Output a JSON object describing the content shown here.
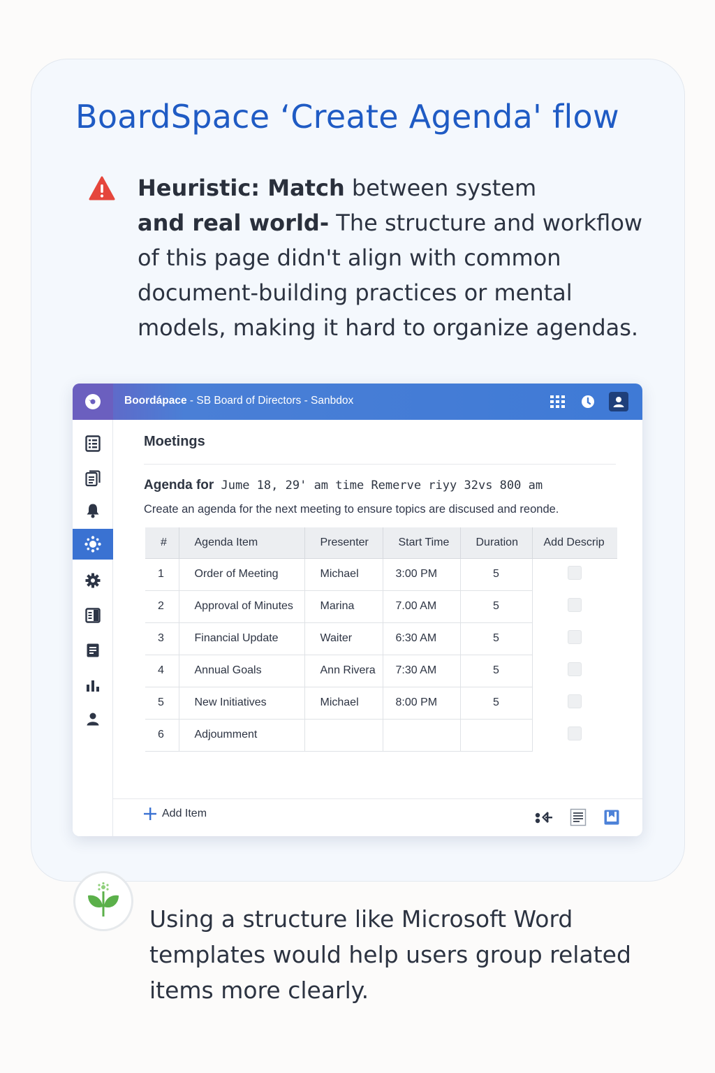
{
  "slide": {
    "title": "BoardSpace ‘Create Agenda' flow",
    "heuristic_bold_1": "Heuristic: Match",
    "heuristic_text_1": " between system",
    "heuristic_bold_2": "and real world-",
    "heuristic_text_2": " The structure and workflow of this page didn't align with common document-building practices or mental models, making it hard to organize agendas.",
    "tip": "Using a structure like Microsoft Word templates would help users group related items more clearly."
  },
  "app": {
    "brand": "Boordápace",
    "context": " - SB Board of Directors - Sanbdox",
    "page_title": "Moetings",
    "agenda_label": "Agenda for",
    "agenda_details": " Jume 18, 29' am time Remerve riyy 32vs 800 am",
    "agenda_description": "Create an agenda for the next meeting to ensure topics are discused and reonde.",
    "add_item_label": "Add Item",
    "columns": [
      "#",
      "Agenda Item",
      "Presenter",
      "Start Time",
      "Duration",
      "Add Descrip"
    ],
    "rows": [
      {
        "num": "1",
        "item": "Order of Meeting",
        "presenter": "Michael",
        "time": "3:00 PM",
        "duration": "5"
      },
      {
        "num": "2",
        "item": "Approval of Minutes",
        "presenter": "Marina",
        "time": "7.00 AM",
        "duration": "5"
      },
      {
        "num": "3",
        "item": "Financial Update",
        "presenter": "Waiter",
        "time": "6:30 AM",
        "duration": "5"
      },
      {
        "num": "4",
        "item": "Annual Goals",
        "presenter": "Ann Rivera",
        "time": "7:30 AM",
        "duration": "5"
      },
      {
        "num": "5",
        "item": "New Initiatives",
        "presenter": "Michael",
        "time": "8:00 PM",
        "duration": "5"
      },
      {
        "num": "6",
        "item": "Adjoumment",
        "presenter": "",
        "time": "",
        "duration": ""
      }
    ],
    "sidebar_icons": [
      "agenda-list-icon",
      "documents-icon",
      "notifications-bell-icon",
      "meetings-icon",
      "settings-gear-icon",
      "board-book-icon",
      "minutes-document-icon",
      "reports-chart-icon",
      "profile-user-icon"
    ],
    "active_sidebar_index": 3
  },
  "colors": {
    "title_blue": "#1f5bc4",
    "topbar_blue": "#3f7ad6",
    "sidebar_active": "#3a72d2",
    "warning_red": "#e5463c",
    "plant_green": "#5bb04a"
  }
}
